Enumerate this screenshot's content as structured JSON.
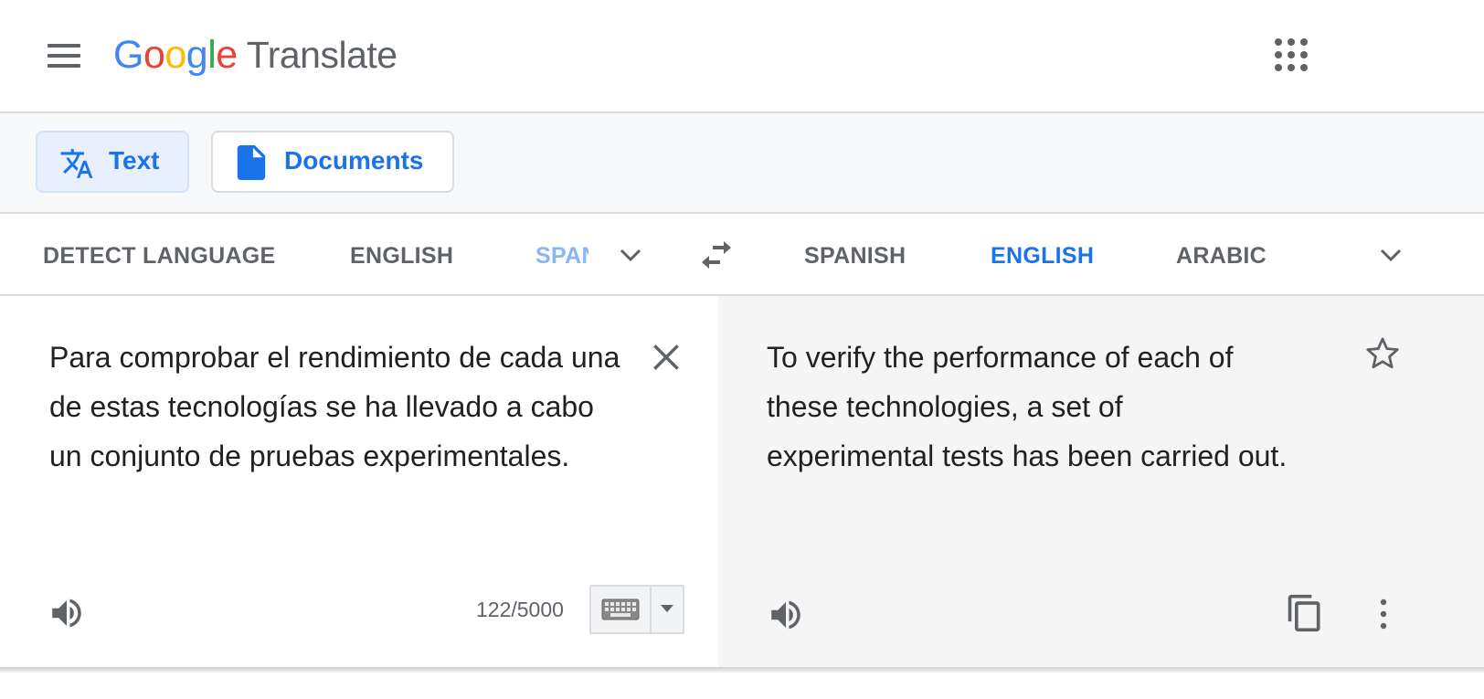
{
  "header": {
    "logo_letters": [
      "G",
      "o",
      "o",
      "g",
      "l",
      "e"
    ],
    "product_name": "Translate",
    "menu_icon": "hamburger-menu-icon",
    "apps_icon": "apps-grid-icon"
  },
  "modes": {
    "text_label": "Text",
    "documents_label": "Documents",
    "active": "Text"
  },
  "source_languages": {
    "detect": "DETECT LANGUAGE",
    "english": "ENGLISH",
    "spanish_truncated": "SPANISH",
    "selected": "SPANISH"
  },
  "target_languages": {
    "spanish": "SPANISH",
    "english": "ENGLISH",
    "arabic": "ARABIC",
    "selected": "ENGLISH"
  },
  "source": {
    "text": "Para comprobar el rendimiento de cada una de estas tecnologías se ha llevado a cabo un conjunto de pruebas experimentales.",
    "char_count": "122/5000"
  },
  "target": {
    "text": "To verify the performance of each of these technologies, a set of experimental tests has been carried out."
  },
  "colors": {
    "accent": "#1a73e8",
    "text": "#202124",
    "muted": "#5f6368",
    "target_bg": "#f5f5f5"
  }
}
